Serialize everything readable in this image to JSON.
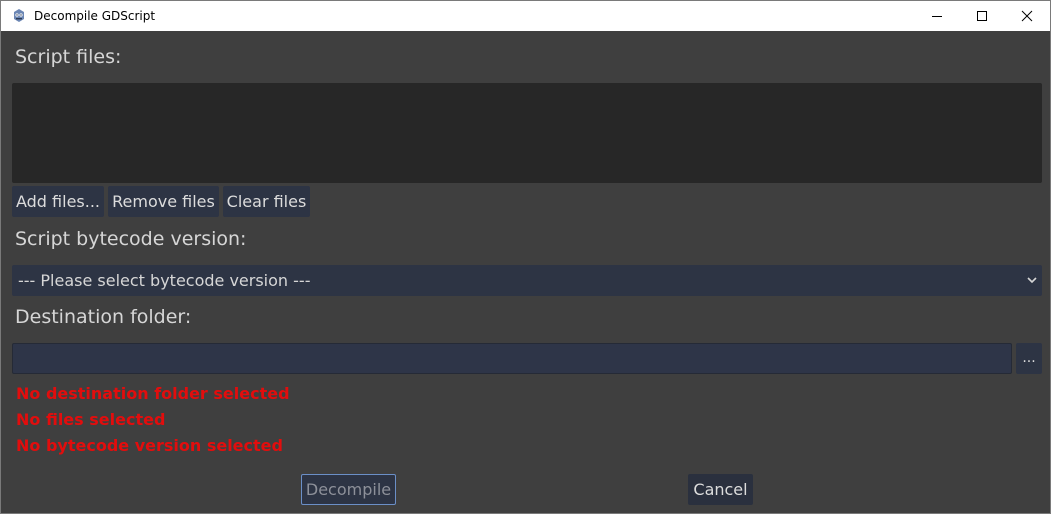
{
  "window": {
    "title": "Decompile GDScript"
  },
  "labels": {
    "script_files": "Script files:",
    "bytecode_version": "Script bytecode version:",
    "destination_folder": "Destination folder:"
  },
  "file_buttons": {
    "add": "Add files...",
    "remove": "Remove files",
    "clear": "Clear files"
  },
  "version_select": {
    "selected": "--- Please select bytecode version ---"
  },
  "destination": {
    "value": "",
    "browse_label": "..."
  },
  "errors": [
    "No destination folder selected",
    "No files selected",
    "No bytecode version selected"
  ],
  "actions": {
    "decompile": "Decompile",
    "cancel": "Cancel"
  },
  "colors": {
    "background": "#3f3f3f",
    "button": "#2d3444",
    "error": "#e20d0d",
    "focus_border": "#6b8fc7"
  },
  "icons": {
    "app": "godot-icon",
    "minimize": "minimize-icon",
    "maximize": "maximize-icon",
    "close": "close-icon",
    "dropdown": "chevron-down-icon"
  }
}
